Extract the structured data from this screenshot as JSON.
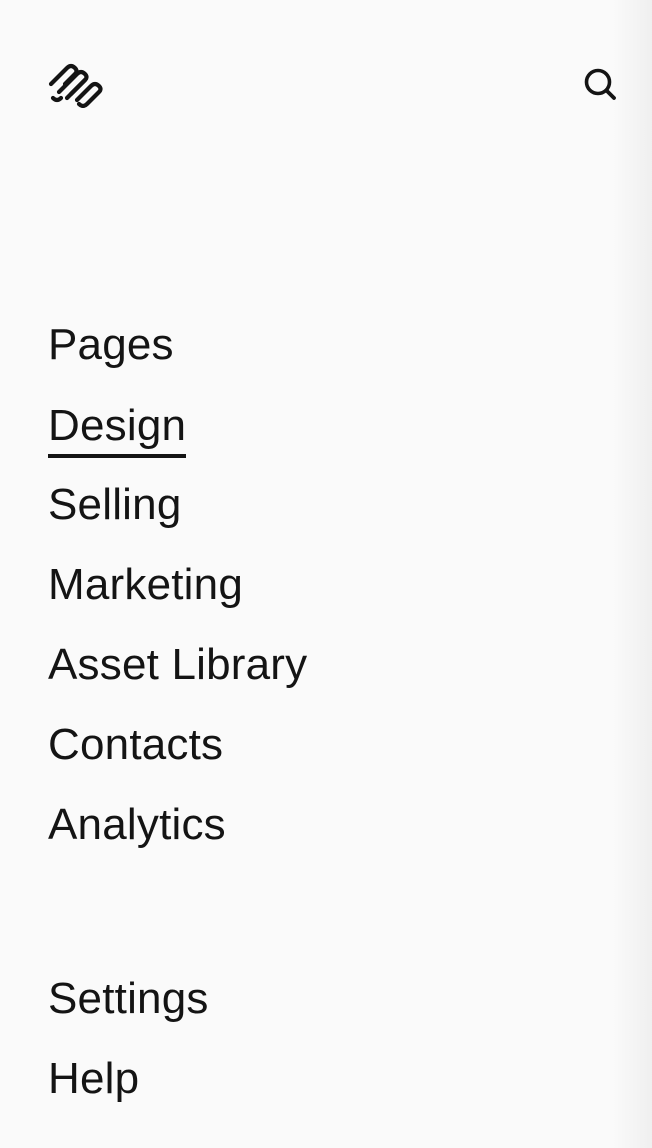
{
  "header": {
    "logo_icon": "squarespace-logo-icon",
    "search_icon": "search-icon"
  },
  "nav": {
    "active": "Design",
    "items": [
      {
        "label": "Pages"
      },
      {
        "label": "Design"
      },
      {
        "label": "Selling"
      },
      {
        "label": "Marketing"
      },
      {
        "label": "Asset Library"
      },
      {
        "label": "Contacts"
      },
      {
        "label": "Analytics"
      }
    ]
  },
  "secondary_nav": {
    "items": [
      {
        "label": "Settings"
      },
      {
        "label": "Help"
      }
    ]
  },
  "colors": {
    "background": "#fafafa",
    "text": "#141414"
  }
}
